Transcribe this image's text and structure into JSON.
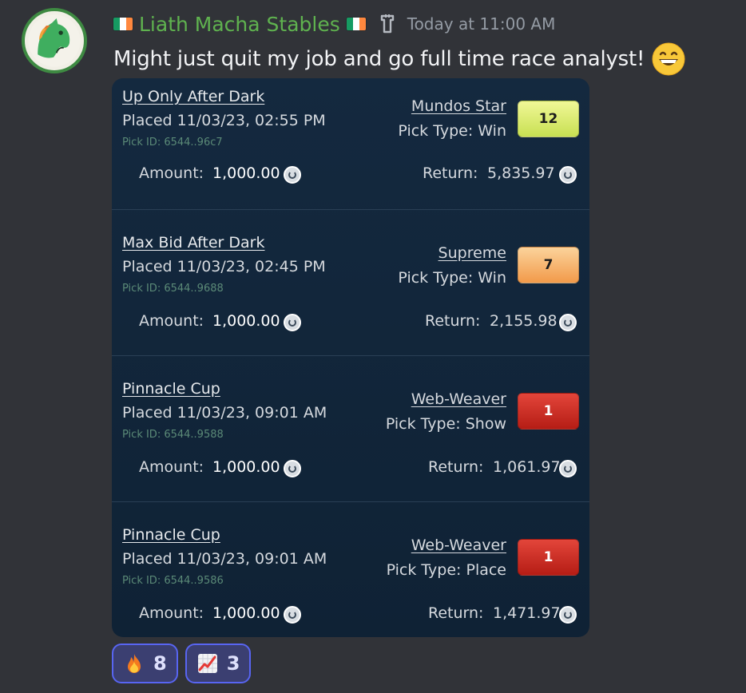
{
  "message": {
    "username": "Liath Macha Stables",
    "timestamp": "Today at 11:00 AM",
    "text": "Might just quit my job and go full time race analyst!",
    "icons": {
      "avatar": "green-horse-avatar",
      "flags": "ireland-flag",
      "tag": "server-tag-icon",
      "emoji": "grinning-face-emoji"
    }
  },
  "picks": [
    {
      "race": "Up Only After Dark",
      "placed": "Placed 11/03/23, 02:55 PM",
      "pick_id": "Pick ID: 6544..96c7",
      "amount_label": "Amount:",
      "amount": "1,000.00",
      "horse": "Mundos Star",
      "pick_type": "Pick Type: Win",
      "number": "12",
      "badge_color": "yellow",
      "return_label": "Return:",
      "return": "5,835.97"
    },
    {
      "race": "Max Bid After Dark",
      "placed": "Placed 11/03/23, 02:45 PM",
      "pick_id": "Pick ID: 6544..9688",
      "amount_label": "Amount:",
      "amount": "1,000.00",
      "horse": "Supreme",
      "pick_type": "Pick Type: Win",
      "number": "7",
      "badge_color": "orange",
      "return_label": "Return:",
      "return": "2,155.98"
    },
    {
      "race": "Pinnacle Cup",
      "placed": "Placed 11/03/23, 09:01 AM",
      "pick_id": "Pick ID: 6544..9588",
      "amount_label": "Amount:",
      "amount": "1,000.00",
      "horse": "Web-Weaver",
      "pick_type": "Pick Type: Show",
      "number": "1",
      "badge_color": "red",
      "return_label": "Return:",
      "return": "1,061.97"
    },
    {
      "race": "Pinnacle Cup",
      "placed": "Placed 11/03/23, 09:01 AM",
      "pick_id": "Pick ID: 6544..9586",
      "amount_label": "Amount:",
      "amount": "1,000.00",
      "horse": "Web-Weaver",
      "pick_type": "Pick Type: Place",
      "number": "1",
      "badge_color": "red",
      "return_label": "Return:",
      "return": "1,471.97"
    }
  ],
  "reactions": [
    {
      "emoji": "fire-emoji",
      "count": "8"
    },
    {
      "emoji": "chart-increasing-emoji",
      "count": "3"
    }
  ],
  "colors": {
    "background": "#313338",
    "username": "#5fb24f",
    "card": "#14293f",
    "reaction_border": "#5865f2"
  }
}
